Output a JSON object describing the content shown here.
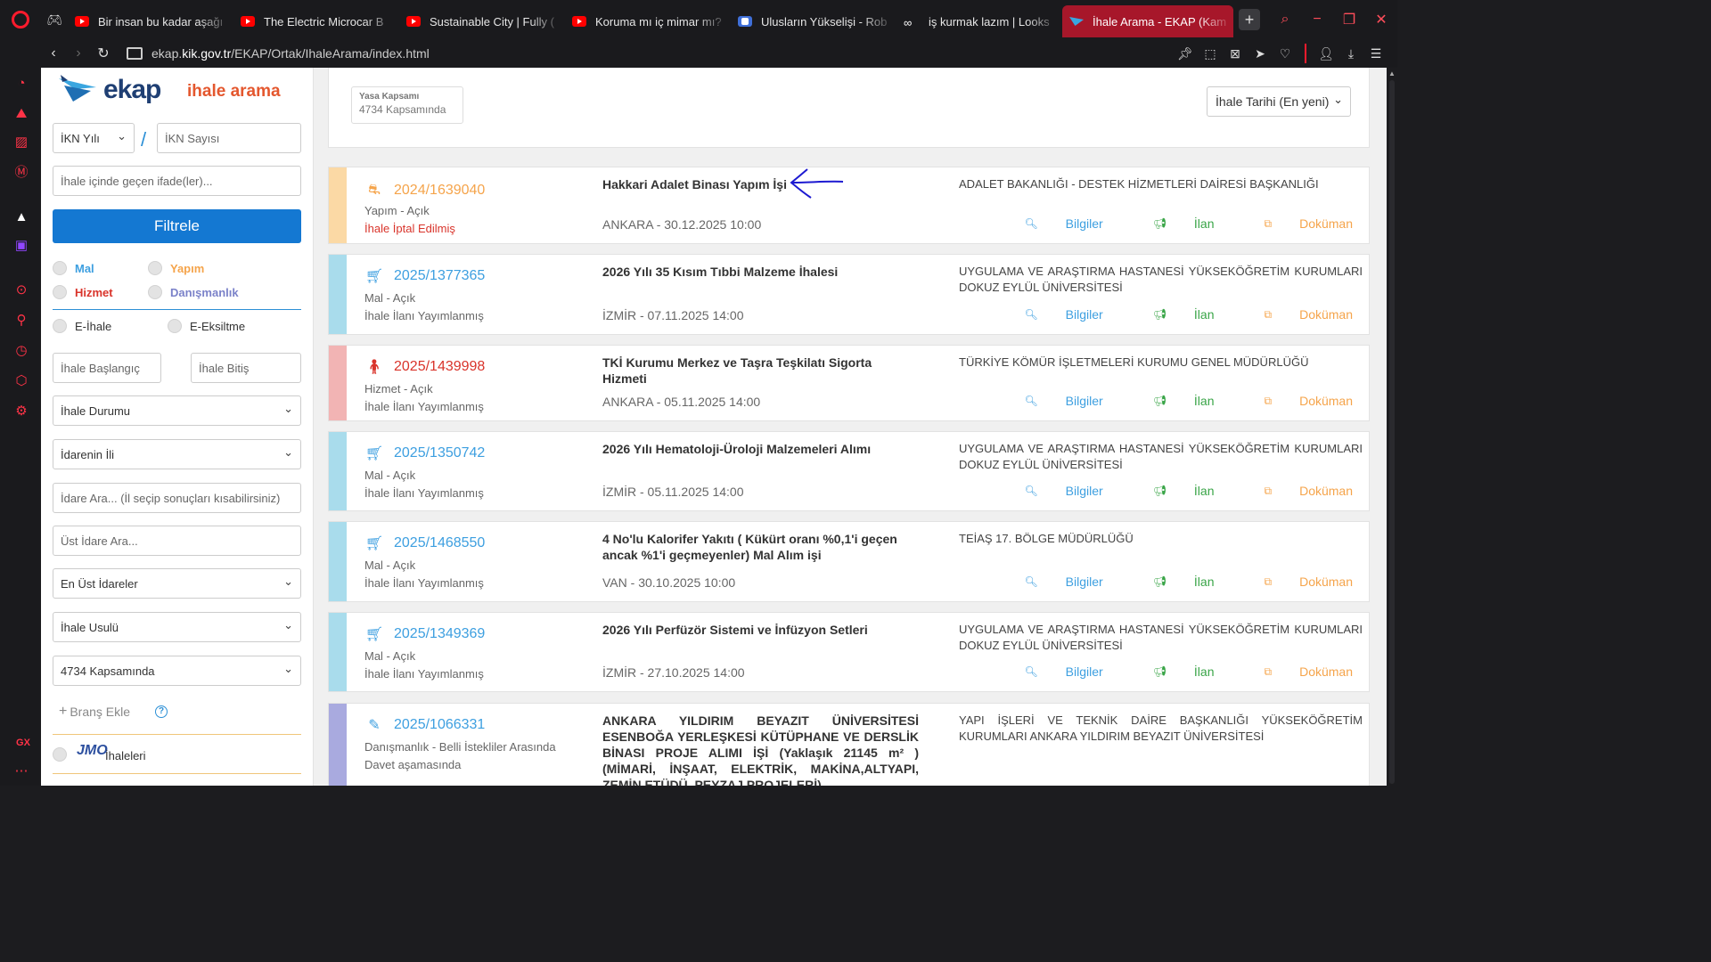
{
  "browser": {
    "tabs": [
      {
        "title": "Bir insan bu kadar aşağı",
        "icon": "youtube-icon"
      },
      {
        "title": "The Electric Microcar B",
        "icon": "youtube-icon"
      },
      {
        "title": "Sustainable City | Fully (",
        "icon": "youtube-icon"
      },
      {
        "title": "Koruma mı iç mimar mı?",
        "icon": "youtube-icon"
      },
      {
        "title": "Ulusların Yükselişi - Rob",
        "icon": "docs-icon"
      },
      {
        "title": "iş kurmak lazım | Looks",
        "icon": "link-icon"
      },
      {
        "title": "İhale Arama - EKAP (Kamu",
        "icon": "ekap-icon",
        "active": true
      }
    ],
    "url_prefix": "ekap.",
    "url_domain": "kik.gov.tr",
    "url_path": "/EKAP/Ortak/IhaleArama/index.html",
    "accent_color": "#ff1b2d"
  },
  "sidebar": {
    "logo_word": "ekap",
    "logo_sub": "ihale arama",
    "ikn_year_label": "İKN Yılı",
    "ikn_number_placeholder": "İKN Sayısı",
    "phrase_placeholder": "İhale içinde geçen ifade(ler)...",
    "filter_button": "Filtrele",
    "types": [
      {
        "label": "Mal",
        "color": "#3d9fe0"
      },
      {
        "label": "Yapım",
        "color": "#f5a44b"
      },
      {
        "label": "Hizmet",
        "color": "#d9342b"
      },
      {
        "label": "Danışmanlık",
        "color": "#7b82c9"
      }
    ],
    "e_ihale": "E-İhale",
    "e_eksiltme": "E-Eksiltme",
    "start_placeholder": "İhale Başlangıç",
    "end_placeholder": "İhale Bitiş",
    "status_select": "İhale Durumu",
    "province_select": "İdarenin İli",
    "admin_search_placeholder": "İdare Ara... (İl seçip sonuçları kısabilirsiniz)",
    "upper_admin_placeholder": "Üst İdare Ara...",
    "top_admin_select": "En Üst İdareler",
    "method_select": "İhale Usulü",
    "scope_select": "4734 Kapsamında",
    "add_branch": "Branş Ekle",
    "jmo_label": "İhaleleri"
  },
  "main": {
    "scope_label": "Yasa Kapsamı",
    "scope_value": "4734 Kapsamında",
    "sort_select": "İhale Tarihi (En yeni)",
    "action_labels": {
      "info": "Bilgiler",
      "notice": "İlan",
      "document": "Doküman"
    },
    "results": [
      {
        "ikn": "2024/1639040",
        "category": "Yapım",
        "category_icon": "road-icon",
        "type": "Yapım - Açık",
        "status": "İhale İptal Edilmiş",
        "title": "Hakkari Adalet Binası Yapım İşi",
        "location": "ANKARA - 30.12.2025 10:00",
        "organization": "ADALET BAKANLIĞI - DESTEK HİZMETLERİ DAİRESİ BAŞKANLIĞI"
      },
      {
        "ikn": "2025/1377365",
        "category": "Mal",
        "category_icon": "cart-icon",
        "type": "Mal - Açık",
        "status": "İhale İlanı Yayımlanmış",
        "title": "2026 Yılı 35 Kısım Tıbbi Malzeme İhalesi",
        "location": "İZMİR - 07.11.2025 14:00",
        "organization": "UYGULAMA VE ARAŞTIRMA HASTANESİ YÜKSEKÖĞRETİM KURUMLARI DOKUZ EYLÜL ÜNİVERSİTESİ"
      },
      {
        "ikn": "2025/1439998",
        "category": "Hizmet",
        "category_icon": "person-icon",
        "type": "Hizmet - Açık",
        "status": "İhale İlanı Yayımlanmış",
        "title": "TKİ Kurumu Merkez ve Taşra Teşkilatı Sigorta Hizmeti",
        "location": "ANKARA - 05.11.2025 14:00",
        "organization": "TÜRKİYE KÖMÜR İŞLETMELERİ KURUMU GENEL MÜDÜRLÜĞÜ"
      },
      {
        "ikn": "2025/1350742",
        "category": "Mal",
        "category_icon": "cart-icon",
        "type": "Mal - Açık",
        "status": "İhale İlanı Yayımlanmış",
        "title": "2026 Yılı Hematoloji-Üroloji Malzemeleri Alımı",
        "location": "İZMİR - 05.11.2025 14:00",
        "organization": "UYGULAMA VE ARAŞTIRMA HASTANESİ YÜKSEKÖĞRETİM KURUMLARI DOKUZ EYLÜL ÜNİVERSİTESİ"
      },
      {
        "ikn": "2025/1468550",
        "category": "Mal",
        "category_icon": "cart-icon",
        "type": "Mal - Açık",
        "status": "İhale İlanı Yayımlanmış",
        "title": "4 No'lu Kalorifer Yakıtı ( Kükürt oranı %0,1'i geçen ancak %1'i geçmeyenler) Mal Alım işi",
        "location": "VAN - 30.10.2025 10:00",
        "organization": "TEİAŞ 17. BÖLGE MÜDÜRLÜĞÜ"
      },
      {
        "ikn": "2025/1349369",
        "category": "Mal",
        "category_icon": "cart-icon",
        "type": "Mal - Açık",
        "status": "İhale İlanı Yayımlanmış",
        "title": "2026 Yılı Perfüzör Sistemi ve İnfüzyon Setleri",
        "location": "İZMİR - 27.10.2025 14:00",
        "organization": "UYGULAMA VE ARAŞTIRMA HASTANESİ YÜKSEKÖĞRETİM KURUMLARI DOKUZ EYLÜL ÜNİVERSİTESİ"
      },
      {
        "ikn": "2025/1066331",
        "category": "Danışmanlık",
        "category_icon": "edit-icon",
        "type": "Danışmanlık - Belli İstekliler Arasında",
        "status": "Davet aşamasında",
        "title": "ANKARA YILDIRIM BEYAZIT ÜNİVERSİTESİ ESENBOĞA YERLEŞKESİ KÜTÜPHANE VE DERSLİK BİNASI PROJE ALIMI İŞİ (Yaklaşık 21145 m² )(MİMARİ, İNŞAAT, ELEKTRİK, MAKİNA,ALTYAPI, ZEMİN ETÜDÜ, PEYZAJ PROJELERİ)",
        "location": "",
        "organization": "YAPI İŞLERİ VE TEKNİK DAİRE BAŞKANLIĞI YÜKSEKÖĞRETİM KURUMLARI ANKARA YILDIRIM BEYAZIT ÜNİVERSİTESİ"
      }
    ]
  }
}
